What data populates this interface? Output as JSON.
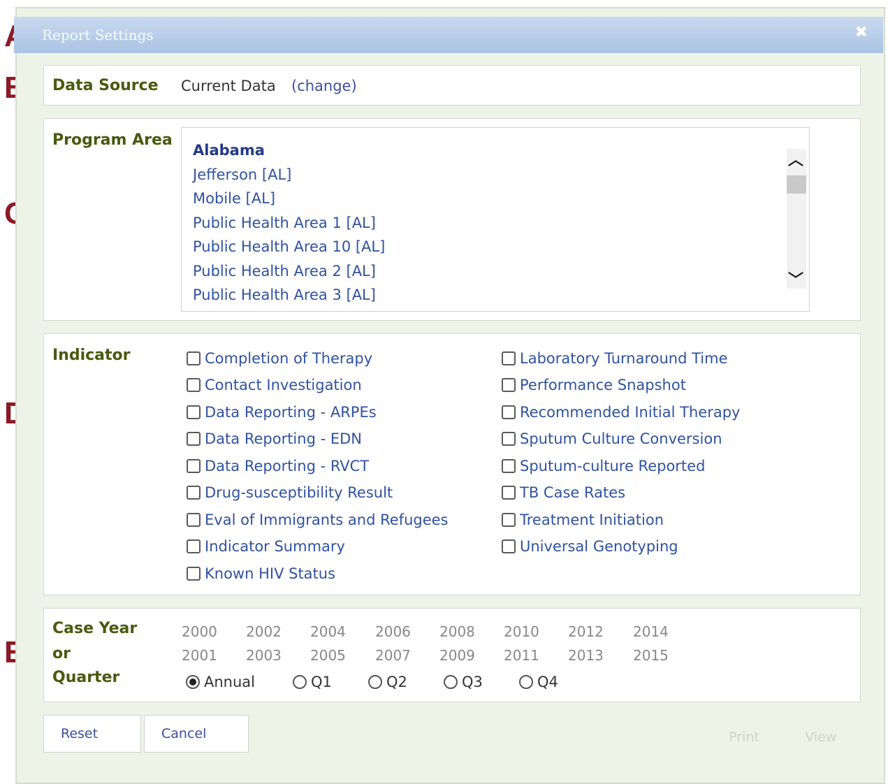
{
  "markers": [
    "A",
    "B",
    "C",
    "D",
    "E"
  ],
  "dialog": {
    "title": "Report Settings",
    "close_icon": "close-icon"
  },
  "data_source": {
    "label": "Data Source",
    "value": "Current Data",
    "change_link": "(change)"
  },
  "program_area": {
    "label": "Program Area",
    "items": [
      "Alabama",
      "Jefferson [AL]",
      "Mobile [AL]",
      "Public Health Area 1 [AL]",
      "Public Health Area 10 [AL]",
      "Public Health Area 2 [AL]",
      "Public Health Area 3 [AL]"
    ],
    "selected": "Alabama"
  },
  "indicator": {
    "label": "Indicator",
    "left": [
      "Completion of Therapy",
      "Contact Investigation",
      "Data Reporting - ARPEs",
      "Data Reporting - EDN",
      "Data Reporting - RVCT",
      "Drug-susceptibility Result",
      "Eval of Immigrants and Refugees",
      "Indicator Summary",
      "Known HIV Status"
    ],
    "right": [
      "Laboratory Turnaround Time",
      "Performance Snapshot",
      "Recommended Initial Therapy",
      "Sputum Culture Conversion",
      "Sputum-culture Reported",
      "TB Case Rates",
      "Treatment Initiation",
      "Universal Genotyping"
    ]
  },
  "case_year": {
    "label_line1": "Case Year",
    "label_line2": "or",
    "label_line3": "Quarter",
    "years_row1": [
      "2000",
      "2002",
      "2004",
      "2006",
      "2008",
      "2010",
      "2012",
      "2014"
    ],
    "years_row2": [
      "2001",
      "2003",
      "2005",
      "2007",
      "2009",
      "2011",
      "2013",
      "2015"
    ],
    "period_options": [
      "Annual",
      "Q1",
      "Q2",
      "Q3",
      "Q4"
    ],
    "selected_period": "Annual"
  },
  "buttons": {
    "reset": "Reset",
    "cancel": "Cancel",
    "print": "Print",
    "view": "View"
  }
}
